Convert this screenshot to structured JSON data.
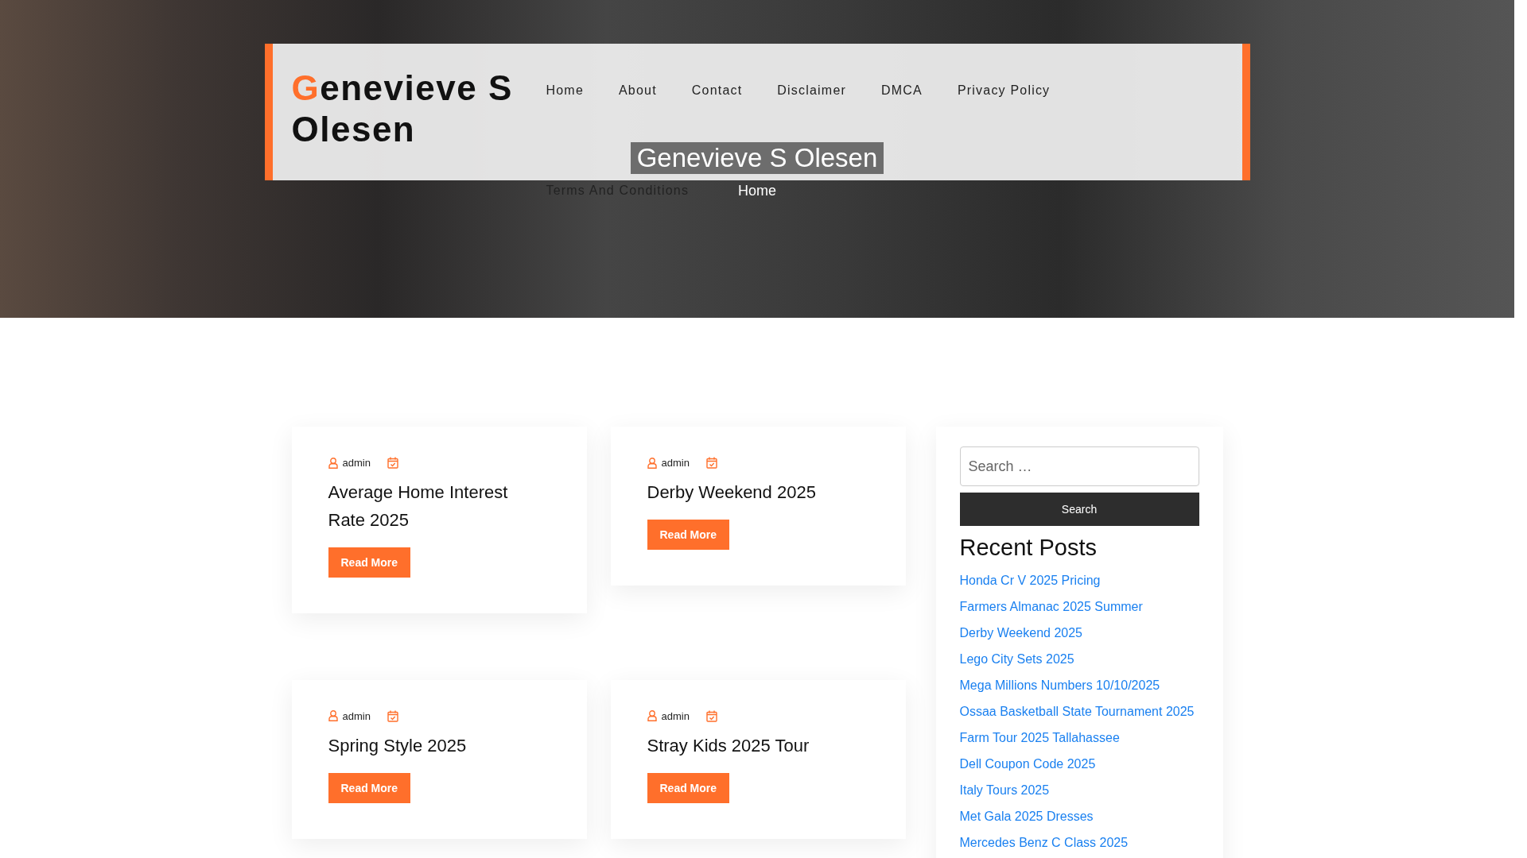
{
  "header": {
    "logo_initial": "G",
    "logo_rest": "enevieve S Olesen",
    "nav": [
      {
        "label": "Home"
      },
      {
        "label": "About"
      },
      {
        "label": "Contact"
      },
      {
        "label": "Disclaimer"
      },
      {
        "label": "DMCA"
      },
      {
        "label": "Privacy Policy"
      },
      {
        "label": "Terms And Conditions"
      }
    ]
  },
  "banner": {
    "title": "Genevieve S Olesen",
    "breadcrumb": "Home"
  },
  "posts": [
    {
      "author": "admin",
      "title": "Average Home Interest Rate 2025",
      "button": "Read More"
    },
    {
      "author": "admin",
      "title": "Derby Weekend 2025",
      "button": "Read More"
    },
    {
      "author": "admin",
      "title": "Spring Style 2025",
      "button": "Read More"
    },
    {
      "author": "admin",
      "title": "Stray Kids 2025 Tour",
      "button": "Read More"
    }
  ],
  "sidebar": {
    "search": {
      "placeholder": "Search …",
      "button": "Search"
    },
    "recent_posts": {
      "heading": "Recent Posts",
      "items": [
        "Honda Cr V 2025 Pricing",
        "Farmers Almanac 2025 Summer",
        "Derby Weekend 2025",
        "Lego City Sets 2025",
        "Mega Millions Numbers 10/10/2025",
        "Ossaa Basketball State Tournament 2025",
        "Farm Tour 2025 Tallahassee",
        "Dell Coupon Code 2025",
        "Italy Tours 2025",
        "Met Gala 2025 Dresses",
        "Mercedes Benz C Class 2025"
      ]
    }
  }
}
